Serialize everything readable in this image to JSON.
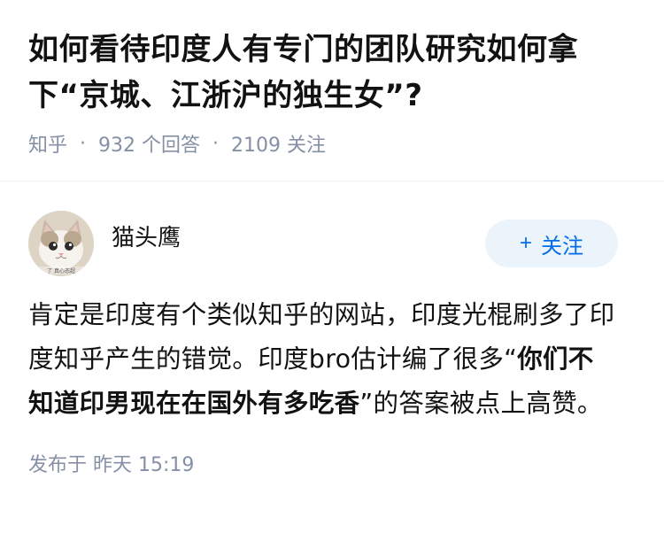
{
  "question": {
    "title": "如何看待印度人有专门的团队研究如何拿下“京城、江浙沪的独生女”?",
    "source": "知乎",
    "answers_count": "932 个回答",
    "followers_count": "2109 关注",
    "separator": "·"
  },
  "answer": {
    "author_name": "猫头鹰",
    "avatar_caption": "了 真心态超",
    "follow_button": {
      "icon": "plus-icon",
      "label": "关注"
    },
    "content_before_bold": "肯定是印度有个类似知乎的网站，印度光棍刷多了印度知乎产生的错觉。印度bro估计编了很多“",
    "content_bold": "你们不知道印男现在在国外有多吃香",
    "content_after_bold": "”的答案被点上高赞。",
    "published": "发布于 昨天 15:19"
  },
  "colors": {
    "meta_gray": "#8590a6",
    "follow_blue": "#056de8",
    "follow_bg": "#ebf3fb"
  }
}
